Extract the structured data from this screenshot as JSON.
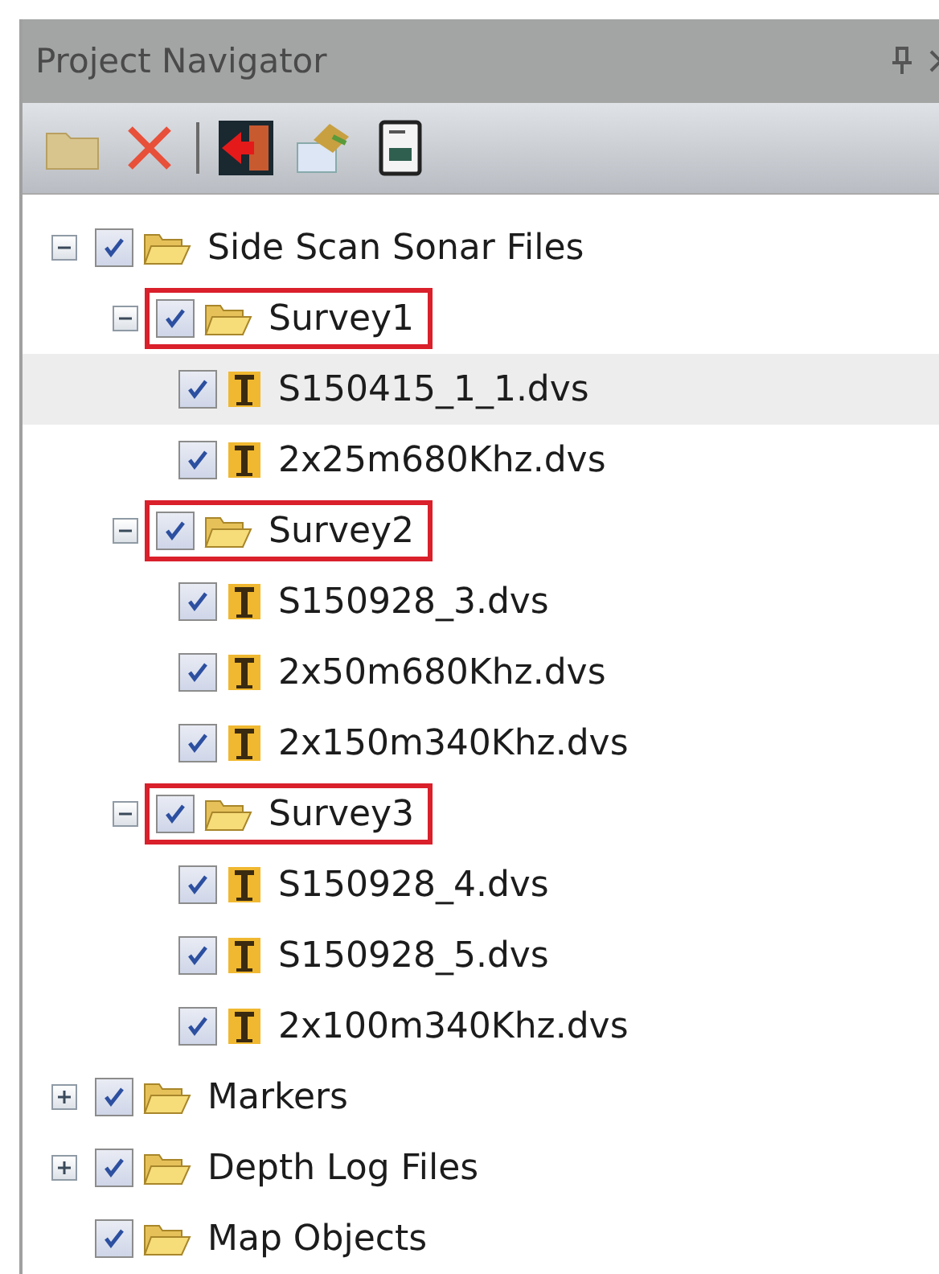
{
  "panel": {
    "title": "Project Navigator"
  },
  "tree": [
    {
      "label": "Side Scan Sonar Files",
      "kind": "folder",
      "checked": true,
      "expanded": true,
      "selected": false,
      "highlighted": false,
      "children": [
        {
          "label": "Survey1",
          "kind": "folder",
          "checked": true,
          "expanded": true,
          "selected": false,
          "highlighted": true,
          "children": [
            {
              "label": "S150415_1_1.dvs",
              "kind": "file",
              "checked": true,
              "selected": true,
              "highlighted": false
            },
            {
              "label": "2x25m680Khz.dvs",
              "kind": "file",
              "checked": true,
              "selected": false,
              "highlighted": false
            }
          ]
        },
        {
          "label": "Survey2",
          "kind": "folder",
          "checked": true,
          "expanded": true,
          "selected": false,
          "highlighted": true,
          "children": [
            {
              "label": "S150928_3.dvs",
              "kind": "file",
              "checked": true,
              "selected": false,
              "highlighted": false
            },
            {
              "label": "2x50m680Khz.dvs",
              "kind": "file",
              "checked": true,
              "selected": false,
              "highlighted": false
            },
            {
              "label": "2x150m340Khz.dvs",
              "kind": "file",
              "checked": true,
              "selected": false,
              "highlighted": false
            }
          ]
        },
        {
          "label": "Survey3",
          "kind": "folder",
          "checked": true,
          "expanded": true,
          "selected": false,
          "highlighted": true,
          "children": [
            {
              "label": "S150928_4.dvs",
              "kind": "file",
              "checked": true,
              "selected": false,
              "highlighted": false
            },
            {
              "label": "S150928_5.dvs",
              "kind": "file",
              "checked": true,
              "selected": false,
              "highlighted": false
            },
            {
              "label": "2x100m340Khz.dvs",
              "kind": "file",
              "checked": true,
              "selected": false,
              "highlighted": false
            }
          ]
        }
      ]
    },
    {
      "label": "Markers",
      "kind": "folder",
      "checked": true,
      "expanded": false,
      "selected": false,
      "highlighted": false
    },
    {
      "label": "Depth Log Files",
      "kind": "folder",
      "checked": true,
      "expanded": false,
      "selected": false,
      "highlighted": false
    },
    {
      "label": "Map Objects",
      "kind": "folder",
      "checked": true,
      "selected": false,
      "highlighted": false
    }
  ]
}
